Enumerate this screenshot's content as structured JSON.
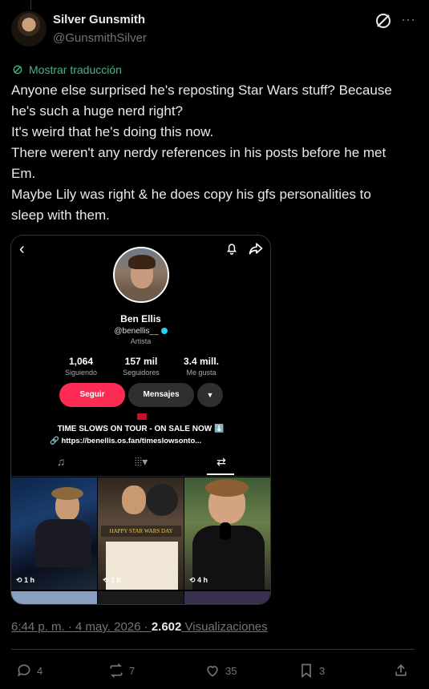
{
  "author": {
    "name": "Silver Gunsmith",
    "handle": "@GunsmithSilver"
  },
  "translate_label": "Mostrar traducción",
  "tweet_lines": [
    "Anyone else surprised he's reposting Star Wars stuff? Because",
    "he's such a huge nerd right?",
    "It's weird that he's doing this now.",
    "There weren't any nerdy references in his posts before he met",
    "Em.",
    "Maybe Lily was right & he does copy his gfs personalities to",
    "sleep with them."
  ],
  "media": {
    "profile_name": "Ben Ellis",
    "profile_user": "@benellis__",
    "profile_role": "Artista",
    "stats": [
      {
        "value": "1,064",
        "label": "Siguiendo"
      },
      {
        "value": "157 mil",
        "label": "Seguidores"
      },
      {
        "value": "3.4 mill.",
        "label": "Me gusta"
      }
    ],
    "follow_label": "Seguir",
    "message_label": "Mensajes",
    "bio_line1": "TIME SLOWS ON TOUR - ON SALE NOW ⬇️",
    "bio_line2": "🔗 https://benellis.os.fan/timeslowsonto...",
    "thumbs": [
      {
        "label": "⟲ 1 h"
      },
      {
        "label": "⟲ 2 h"
      },
      {
        "label": "⟲ 4 h"
      }
    ]
  },
  "meta": {
    "time": "6:44 p. m. · 4 may. 2026 · ",
    "views_count": "2.602",
    "views_label": " Visualizaciones"
  },
  "actions": {
    "replies": "4",
    "reposts": "7",
    "likes": "35",
    "bookmarks": "3"
  },
  "colors": {
    "background": "#000000",
    "text": "#e7e9ea",
    "muted": "#71767b",
    "follow_button": "#fe2c55"
  }
}
